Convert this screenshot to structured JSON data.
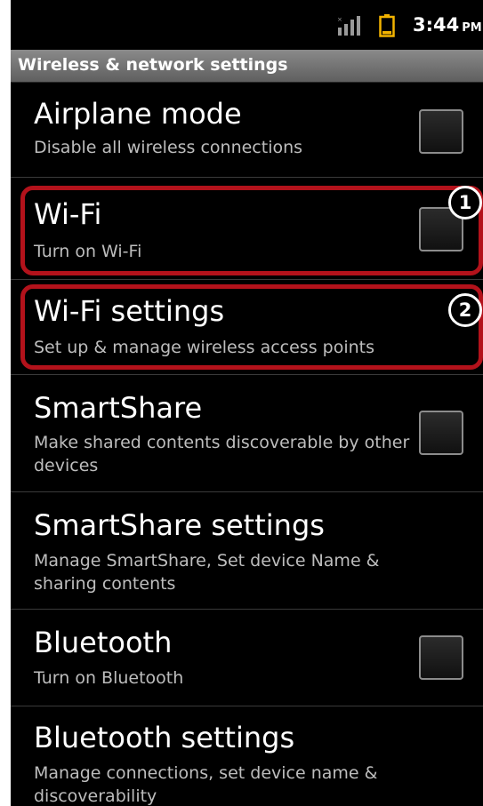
{
  "status_bar": {
    "time": "3:44",
    "ampm": "PM",
    "signal_icon": "signal-icon",
    "battery_icon": "battery-icon"
  },
  "header": {
    "title": "Wireless & network settings"
  },
  "settings": [
    {
      "key": "airplane",
      "title": "Airplane mode",
      "summary": "Disable all wireless connections",
      "has_checkbox": true,
      "checked": false
    },
    {
      "key": "wifi",
      "title": "Wi-Fi",
      "summary": "Turn on Wi-Fi",
      "has_checkbox": true,
      "checked": false
    },
    {
      "key": "wifi_settings",
      "title": "Wi-Fi settings",
      "summary": "Set up & manage wireless access points",
      "has_checkbox": false
    },
    {
      "key": "smartshare",
      "title": "SmartShare",
      "summary": "Make shared contents discoverable by other devices",
      "has_checkbox": true,
      "checked": false
    },
    {
      "key": "smartshare_settings",
      "title": "SmartShare settings",
      "summary": "Manage SmartShare, Set device Name & sharing contents",
      "has_checkbox": false
    },
    {
      "key": "bluetooth",
      "title": "Bluetooth",
      "summary": "Turn on Bluetooth",
      "has_checkbox": true,
      "checked": false
    },
    {
      "key": "bluetooth_settings",
      "title": "Bluetooth settings",
      "summary": "Manage connections, set device name & discoverability",
      "has_checkbox": false
    }
  ],
  "annotations": [
    {
      "number": "1",
      "target": "wifi"
    },
    {
      "number": "2",
      "target": "wifi_settings"
    }
  ],
  "colors": {
    "background": "#000000",
    "title_bar": "#7a7a7a",
    "annotation_red": "#b3121b",
    "summary_text": "#bdbdbd"
  }
}
